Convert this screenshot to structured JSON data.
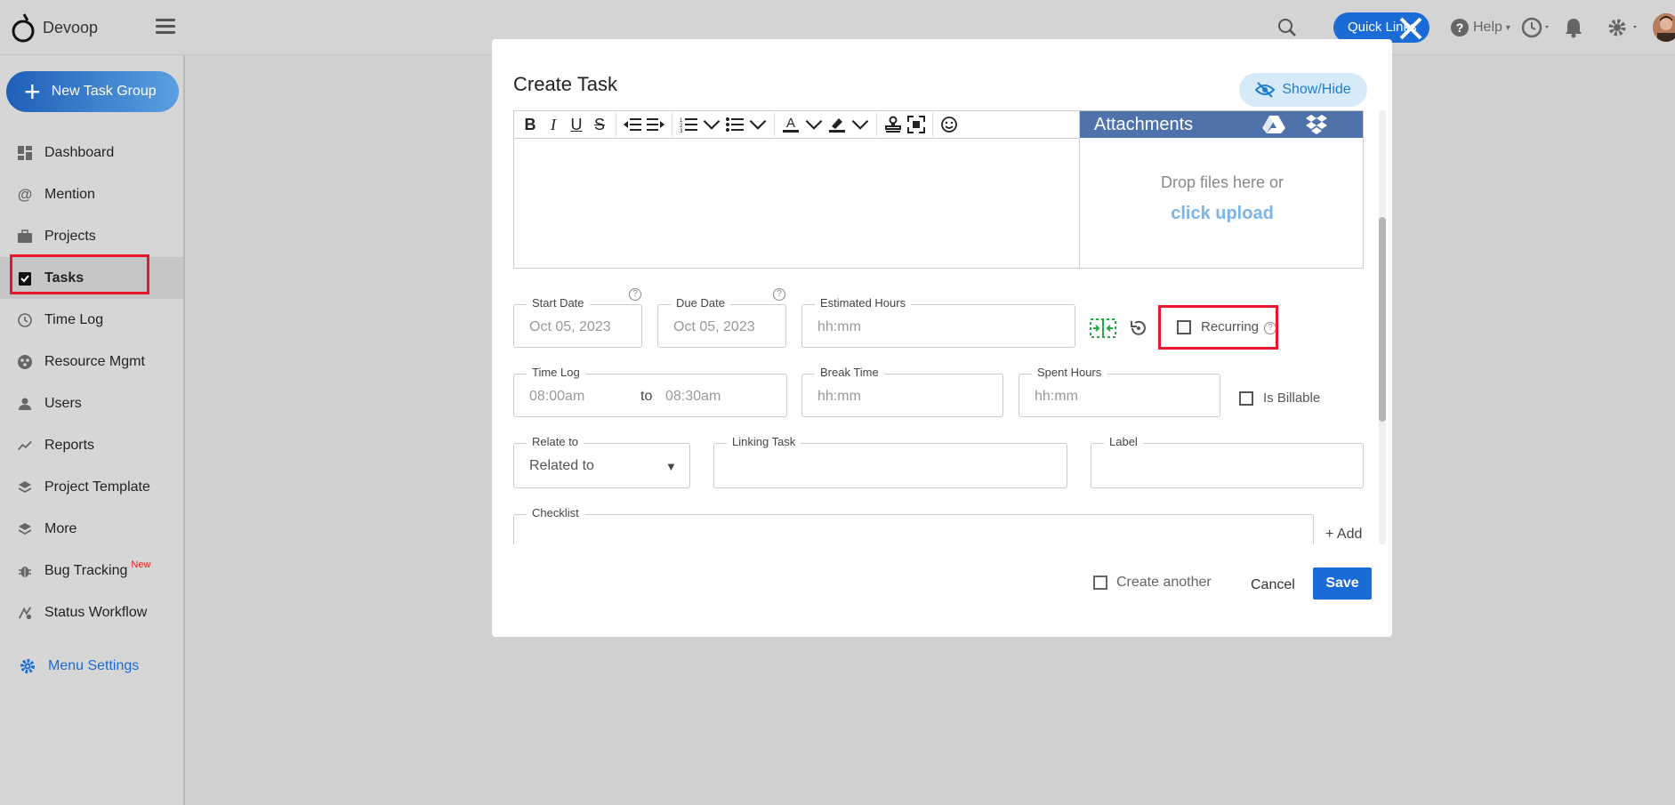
{
  "app": {
    "brand": "Devoop"
  },
  "topbar": {
    "quick_links": "Quick Links",
    "help": "Help"
  },
  "sidebar": {
    "new_task_group": "New Task Group",
    "items": [
      {
        "label": "Dashboard",
        "icon": "dashboard-icon"
      },
      {
        "label": "Mention",
        "icon": "at-icon"
      },
      {
        "label": "Projects",
        "icon": "briefcase-icon"
      },
      {
        "label": "Tasks",
        "icon": "tasks-icon",
        "active": true
      },
      {
        "label": "Time Log",
        "icon": "clock-icon"
      },
      {
        "label": "Resource Mgmt",
        "icon": "resource-icon"
      },
      {
        "label": "Users",
        "icon": "user-icon"
      },
      {
        "label": "Reports",
        "icon": "chart-line-icon"
      },
      {
        "label": "Project Template",
        "icon": "layers-icon"
      },
      {
        "label": "More",
        "icon": "layers-icon"
      },
      {
        "label": "Bug Tracking",
        "icon": "bug-icon",
        "badge": "New"
      },
      {
        "label": "Status Workflow",
        "icon": "workflow-icon"
      }
    ],
    "menu_settings": "Menu Settings"
  },
  "modal": {
    "title": "Create Task",
    "show_hide": "Show/Hide",
    "attachments": {
      "title": "Attachments",
      "drop_text": "Drop files here or",
      "upload_link": "click upload"
    },
    "fields": {
      "start_date": {
        "label": "Start Date",
        "value": "Oct 05, 2023"
      },
      "due_date": {
        "label": "Due Date",
        "value": "Oct 05, 2023"
      },
      "estimated_hours": {
        "label": "Estimated Hours",
        "placeholder": "hh:mm"
      },
      "recurring": {
        "label": "Recurring",
        "checked": false
      },
      "time_log": {
        "label": "Time Log",
        "from": "08:00am",
        "to_word": "to",
        "to": "08:30am"
      },
      "break_time": {
        "label": "Break Time",
        "placeholder": "hh:mm"
      },
      "spent_hours": {
        "label": "Spent Hours",
        "placeholder": "hh:mm"
      },
      "is_billable": {
        "label": "Is Billable",
        "checked": false
      },
      "relate_to": {
        "label": "Relate to",
        "value": "Related to"
      },
      "linking_task": {
        "label": "Linking Task",
        "value": ""
      },
      "label": {
        "label": "Label",
        "value": ""
      },
      "checklist": {
        "label": "Checklist",
        "add": "+ Add"
      }
    },
    "footer": {
      "create_another": "Create another",
      "cancel": "Cancel",
      "save": "Save"
    }
  },
  "colors": {
    "accent": "#1a6bd6",
    "highlight": "#e8182c",
    "attach_header": "#4f72aa"
  }
}
